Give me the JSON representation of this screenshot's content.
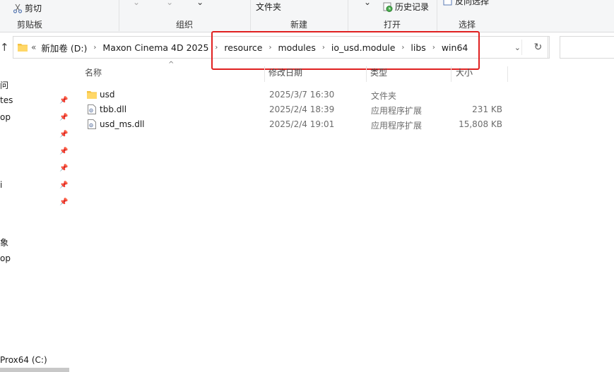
{
  "ribbon": {
    "cut_label": "剪切",
    "groups": [
      "剪贴板",
      "组织",
      "新建",
      "打开",
      "选择"
    ],
    "new_folder_label": "文件夹",
    "history_label": "历史记录",
    "invert_select_label": "反向选择"
  },
  "address": {
    "overflow": "«",
    "breadcrumbs": [
      "新加卷 (D:)",
      "Maxon Cinema 4D 2025",
      "resource",
      "modules",
      "io_usd.module",
      "libs",
      "win64"
    ]
  },
  "nav": {
    "items": [
      "问",
      "tes",
      "op",
      "",
      "",
      "i",
      "",
      "象",
      "op",
      "Prox64 (C:)"
    ]
  },
  "columns": {
    "name": "名称",
    "modified": "修改日期",
    "type": "类型",
    "size": "大小"
  },
  "files": [
    {
      "name": "usd",
      "modified": "2025/3/7 16:30",
      "type": "文件夹",
      "size": "",
      "kind": "folder"
    },
    {
      "name": "tbb.dll",
      "modified": "2025/2/4 18:39",
      "type": "应用程序扩展",
      "size": "231 KB",
      "kind": "dll"
    },
    {
      "name": "usd_ms.dll",
      "modified": "2025/2/4 19:01",
      "type": "应用程序扩展",
      "size": "15,808 KB",
      "kind": "dll"
    }
  ],
  "colors": {
    "highlight": "#e02020",
    "folder": "#f5c342"
  }
}
